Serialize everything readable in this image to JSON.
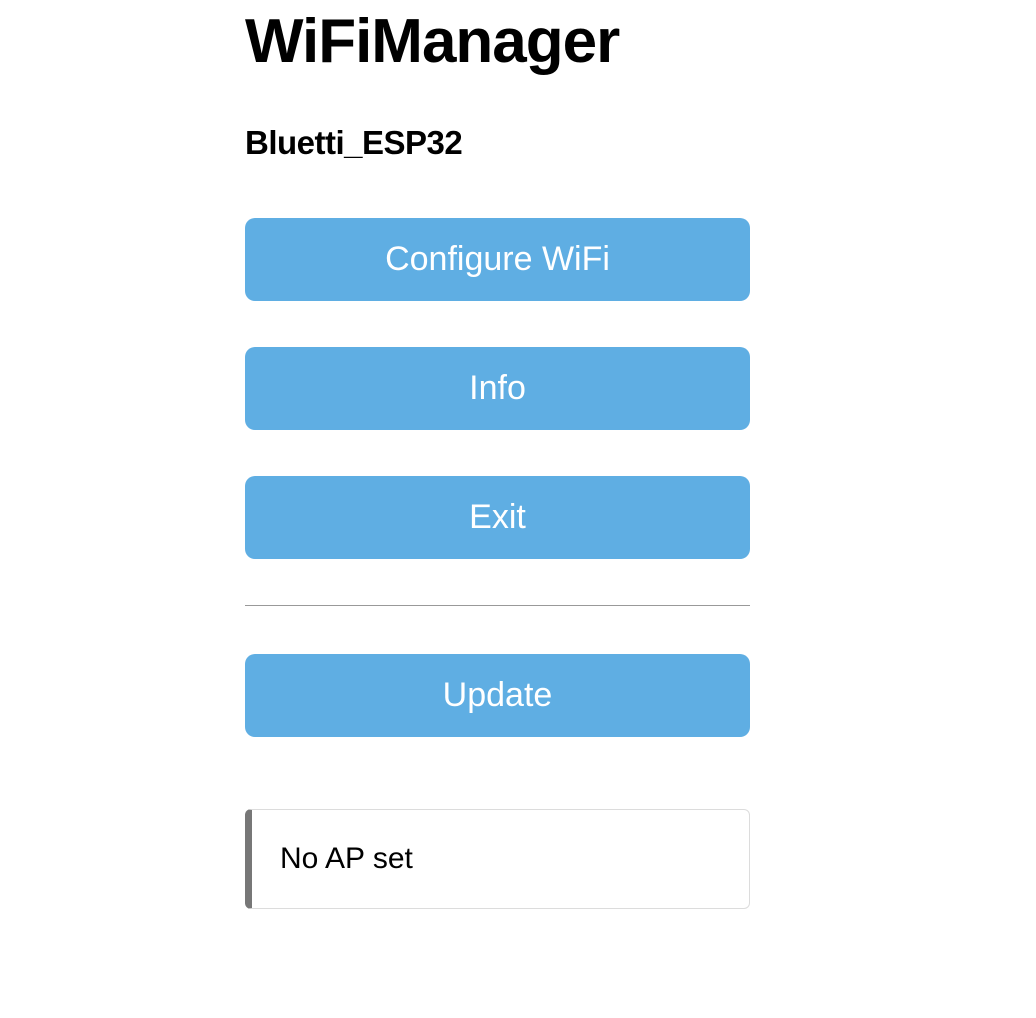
{
  "header": {
    "title": "WiFiManager",
    "subtitle": "Bluetti_ESP32"
  },
  "buttons": {
    "configure_wifi": "Configure WiFi",
    "info": "Info",
    "exit": "Exit",
    "update": "Update"
  },
  "status": {
    "message": "No AP set"
  },
  "colors": {
    "button_bg": "#5faee3",
    "button_text": "#ffffff",
    "status_accent": "#777777"
  }
}
